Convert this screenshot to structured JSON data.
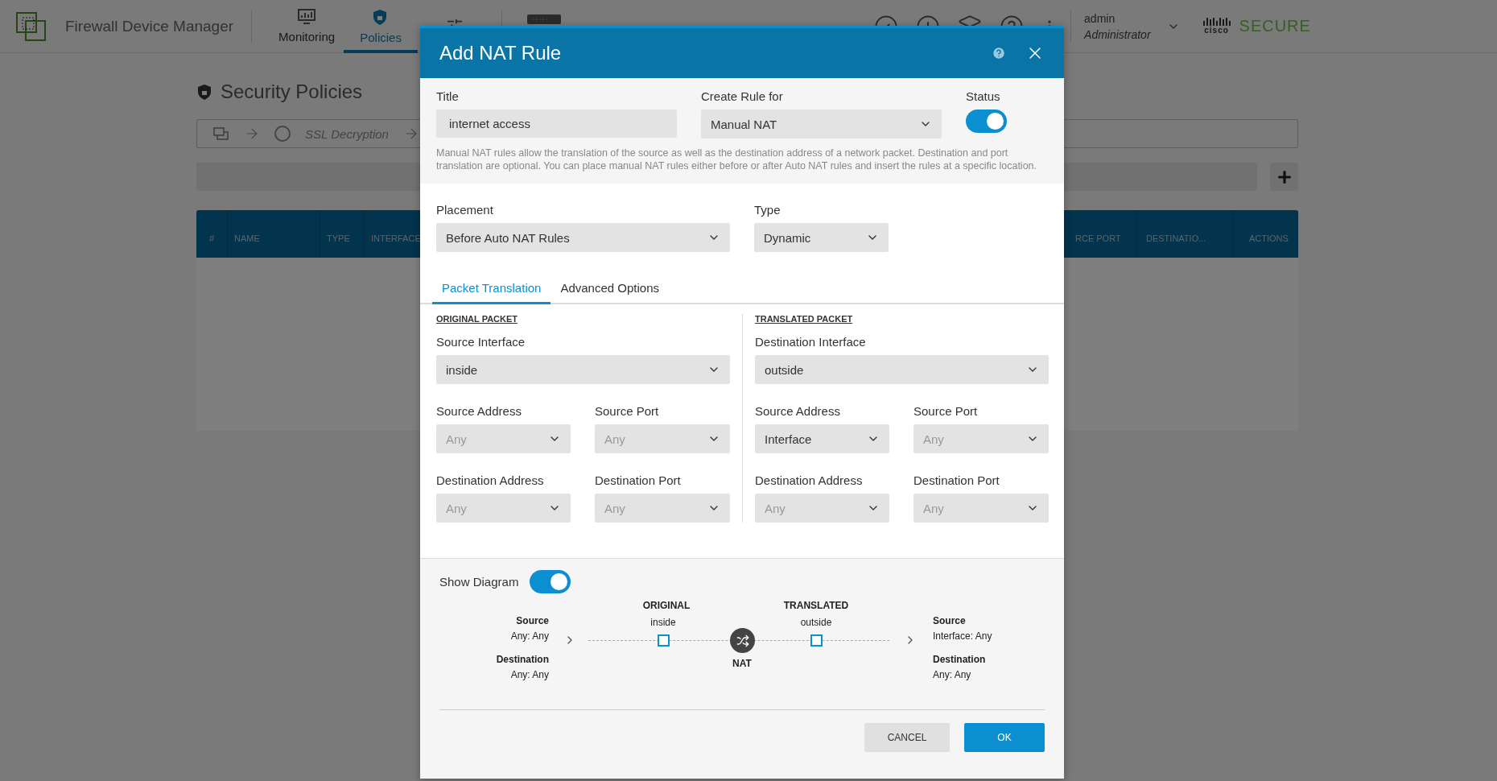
{
  "app": {
    "title": "Firewall Device Manager",
    "nav": [
      {
        "kind": "monitoring",
        "label": "Monitoring",
        "selected": false
      },
      {
        "kind": "policies",
        "label": "Policies",
        "selected": true
      },
      {
        "kind": "objects",
        "selected": false
      },
      {
        "kind": "device"
      }
    ],
    "user": {
      "name": "admin",
      "role": "Administrator"
    },
    "brand": {
      "mark": "cisco",
      "name": "SECURE"
    }
  },
  "page": {
    "heading": "Security Policies",
    "flow": [
      {
        "kind": "source"
      },
      {
        "kind": "step",
        "label": "SSL Decryption"
      }
    ],
    "table": {
      "columns_left": [
        "#",
        "NAME",
        "TYPE",
        "INTERFACE"
      ],
      "columns_right": [
        "RCE PORT",
        "DESTINATIO...",
        "ACTIONS"
      ]
    }
  },
  "dialog": {
    "title": "Add NAT Rule",
    "title_field": {
      "label": "Title",
      "value": "internet access"
    },
    "rule_for": {
      "label": "Create Rule for",
      "value": "Manual NAT"
    },
    "status": {
      "label": "Status",
      "on": true
    },
    "description": "Manual NAT rules allow the translation of the source as well as the destination address of a network packet. Destination and port translation are optional. You can place manual NAT rules either before or after Auto NAT rules and insert the rules at a specific location.",
    "placement": {
      "label": "Placement",
      "value": "Before Auto NAT Rules"
    },
    "type": {
      "label": "Type",
      "value": "Dynamic"
    },
    "tabs": [
      {
        "label": "Packet Translation",
        "selected": true
      },
      {
        "label": "Advanced Options",
        "selected": false
      }
    ],
    "packets": [
      {
        "heading": "ORIGINAL PACKET",
        "interface": {
          "label": "Source Interface",
          "value": "inside"
        },
        "fields": [
          {
            "label": "Source Address",
            "placeholder": "Any"
          },
          {
            "label": "Source Port",
            "placeholder": "Any"
          },
          {
            "label": "Destination Address",
            "placeholder": "Any"
          },
          {
            "label": "Destination Port",
            "placeholder": "Any"
          }
        ]
      },
      {
        "heading": "TRANSLATED PACKET",
        "interface": {
          "label": "Destination Interface",
          "value": "outside"
        },
        "fields": [
          {
            "label": "Source Address",
            "value": "Interface"
          },
          {
            "label": "Source Port",
            "placeholder": "Any"
          },
          {
            "label": "Destination Address",
            "placeholder": "Any"
          },
          {
            "label": "Destination Port",
            "placeholder": "Any"
          }
        ]
      }
    ],
    "show_diagram": {
      "label": "Show Diagram",
      "on": true
    },
    "diagram": {
      "original": "ORIGINAL",
      "translated": "TRANSLATED",
      "original_interface": "inside",
      "translated_interface": "outside",
      "nat": "NAT",
      "left": [
        {
          "label": "Source",
          "value": "Any: Any"
        },
        {
          "label": "Destination",
          "value": "Any: Any"
        }
      ],
      "right": [
        {
          "label": "Source",
          "value": "Interface: Any"
        },
        {
          "label": "Destination",
          "value": "Any: Any"
        }
      ]
    },
    "buttons": [
      {
        "kind": "secondary",
        "label": "CANCEL"
      },
      {
        "kind": "primary",
        "label": "OK"
      }
    ]
  }
}
